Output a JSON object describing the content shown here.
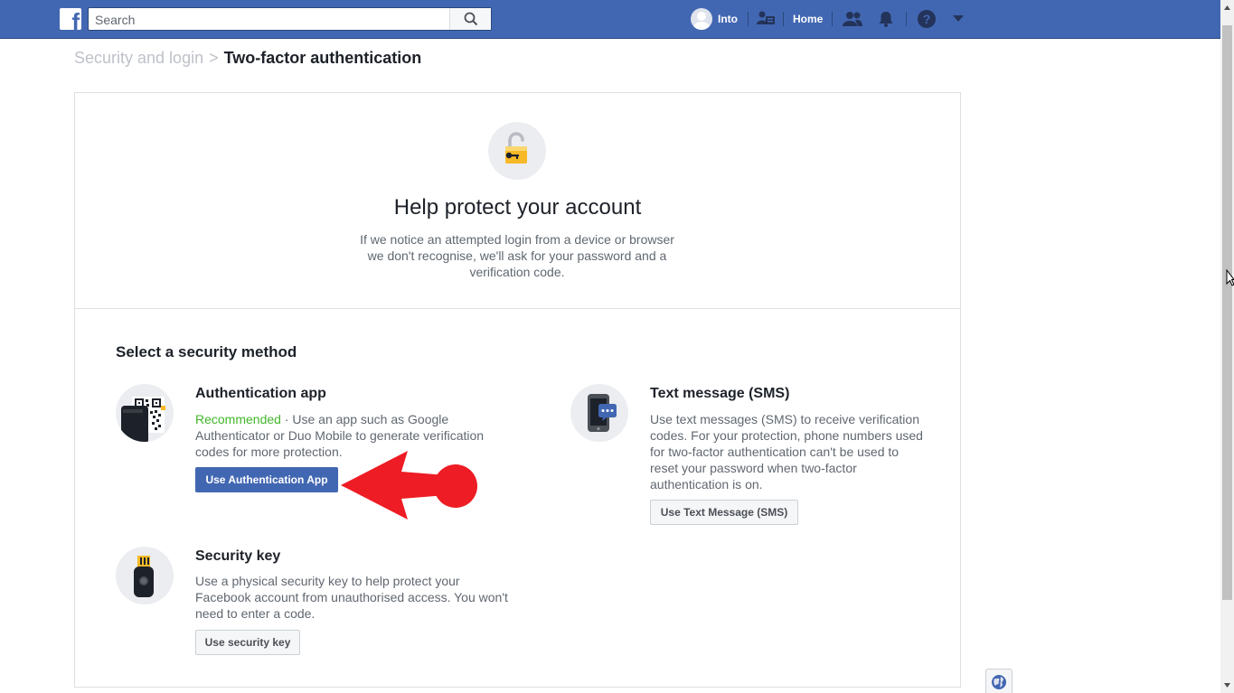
{
  "header": {
    "logo_letter": "f",
    "search": {
      "placeholder": "Search",
      "value": ""
    },
    "profile_name": "Into",
    "home_label": "Home",
    "brand_color": "#4267b2"
  },
  "breadcrumb": {
    "parent": "Security and login",
    "separator": ">",
    "current": "Two-factor authentication"
  },
  "hero": {
    "icon": "lock-key-icon",
    "title": "Help protect your account",
    "description": "If we notice an attempted login from a device or browser we don't recognise, we'll ask for your password and a verification code."
  },
  "methods_section": {
    "title": "Select a security method",
    "methods": [
      {
        "icon": "qr-code-phone-icon",
        "title": "Authentication app",
        "badge": "Recommended",
        "badge_color": "#42b72a",
        "description": " · Use an app such as Google Authenticator or Duo Mobile to generate verification codes for more protection.",
        "button": "Use Authentication App"
      },
      {
        "icon": "phone-sms-icon",
        "title": "Text message (SMS)",
        "description": "Use text messages (SMS) to receive verification codes. For your protection, phone numbers used for two-factor authentication can't be used to reset your password when two-factor authentication is on.",
        "button": "Use Text Message (SMS)"
      },
      {
        "icon": "usb-security-key-icon",
        "title": "Security key",
        "description": "Use a physical security key to help protect your Facebook account from unauthorised access. You won't need to enter a code.",
        "button": "Use security key"
      }
    ]
  },
  "annotation": {
    "color": "#ee1c24",
    "icon": "red-pointer-arrow"
  }
}
